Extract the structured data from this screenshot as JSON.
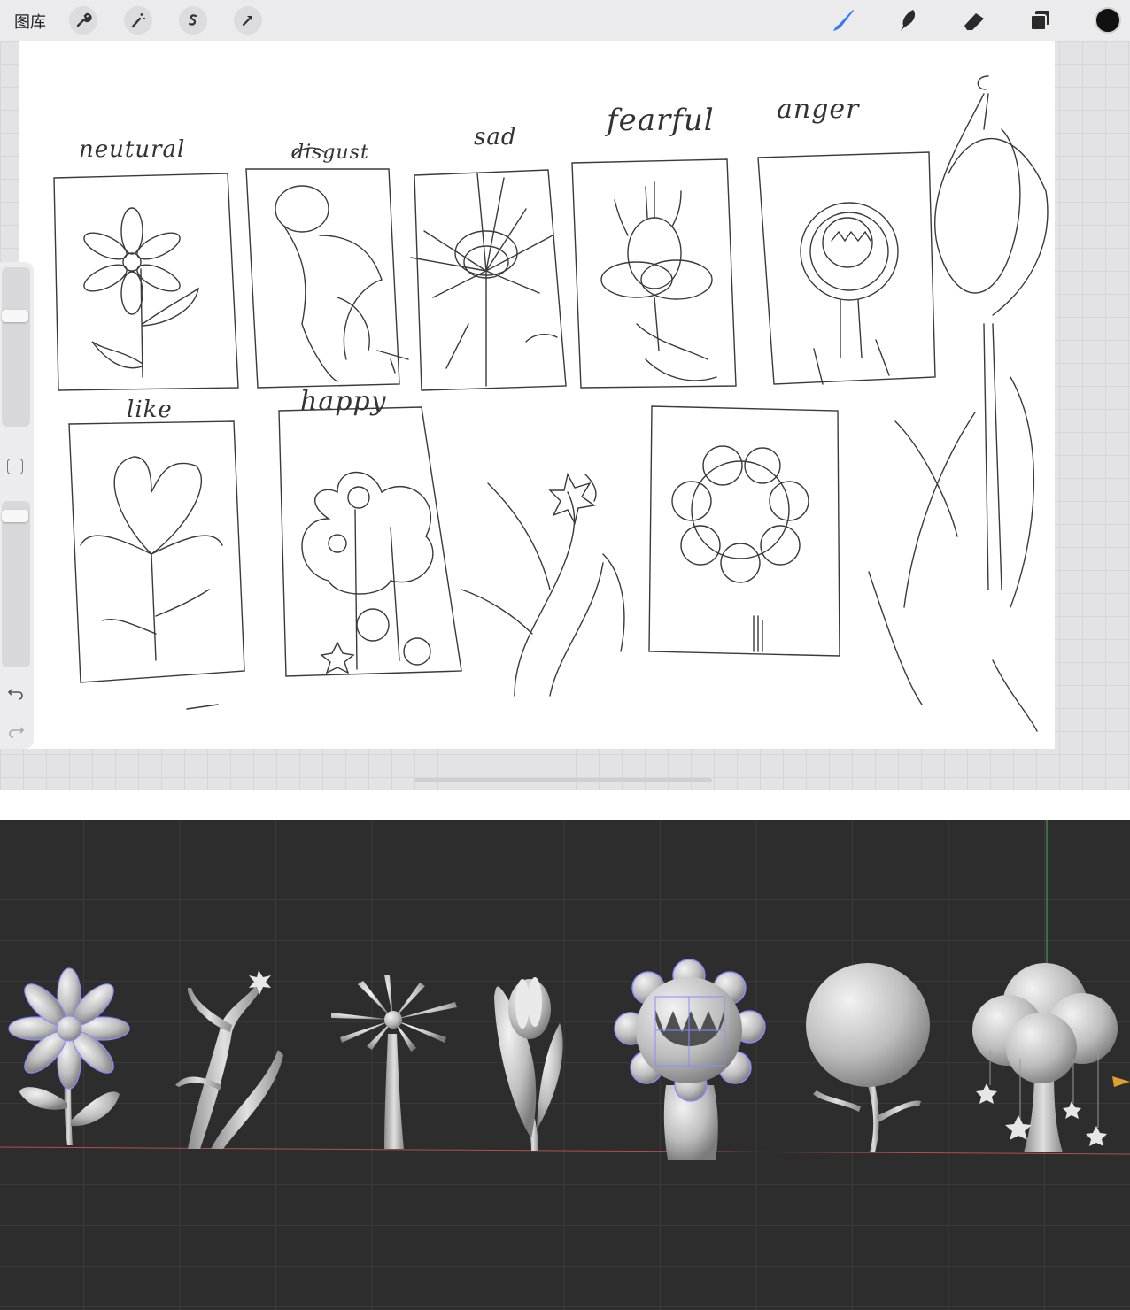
{
  "toolbar": {
    "gallery_label": "图库",
    "left_icons": [
      "wrench-icon",
      "magic-wand-icon",
      "selection-s-icon",
      "transform-arrow-icon"
    ],
    "right_tools": [
      "brush-icon",
      "smudge-icon",
      "eraser-icon",
      "layers-icon",
      "color-icon"
    ],
    "accent": "#2f7cf6",
    "active_color": "#111111"
  },
  "sketch": {
    "labels": [
      "neutural",
      "disgust",
      "sad",
      "fearful",
      "anger",
      "like",
      "happy"
    ]
  },
  "viewport": {
    "background": "#2d2d2d",
    "selection_color": "#8c8cff",
    "x_axis_color": "#b05050",
    "z_axis_color": "#4caf50",
    "models": [
      "daisy-model",
      "thorny-vine-model",
      "spiky-flower-model",
      "tulip-model",
      "sunflower-monster-model",
      "ball-flower-model",
      "cloud-tree-model"
    ]
  }
}
